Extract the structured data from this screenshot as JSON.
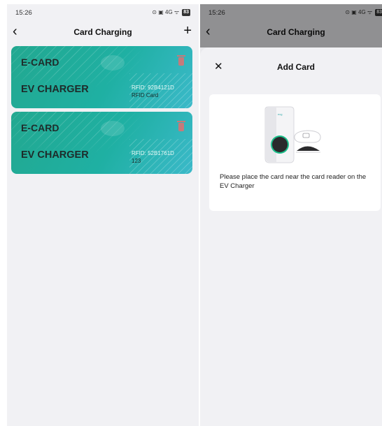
{
  "status_bar": {
    "time": "15:26",
    "icons_text": "⊙ ▣ 4G ᯤ",
    "battery": "83"
  },
  "list_screen": {
    "title": "Card Charging",
    "cards": [
      {
        "brand": "E-CARD",
        "product": "EV CHARGER",
        "rfid": "RFID: 92B4121D",
        "name": "RFID Card"
      },
      {
        "brand": "E-CARD",
        "product": "EV CHARGER",
        "rfid": "RFID: 52B1761D",
        "name": "123"
      }
    ]
  },
  "add_card_screen": {
    "bg_title": "Card Charging",
    "sheet_title": "Add Card",
    "message": "Please place the card near the card reader on the EV Charger"
  },
  "colors": {
    "card_gradient_start": "#22a890",
    "card_gradient_end": "#3bb9c9",
    "charger_ring": "#1bbf8a"
  }
}
